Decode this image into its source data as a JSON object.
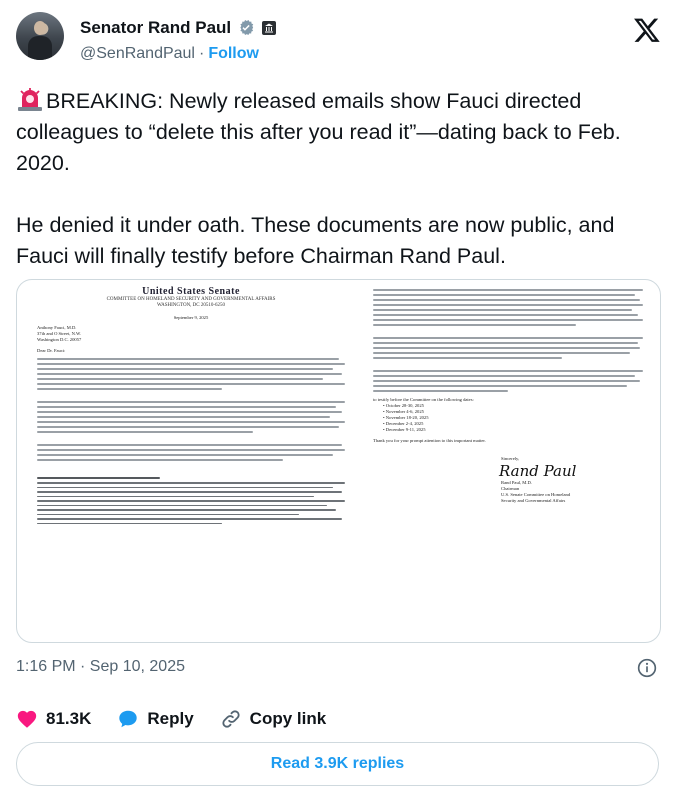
{
  "author": {
    "display_name": "Senator Rand Paul",
    "handle": "@SenRandPaul",
    "separator": "·",
    "follow_label": "Follow"
  },
  "tweet": {
    "paragraph1": "BREAKING: Newly released emails show Fauci directed colleagues to “delete this after you read it”—dating back to Feb. 2020.",
    "paragraph2": "He denied it under oath. These documents are now public, and Fauci will finally testify before Chairman Rand Paul."
  },
  "document": {
    "letterhead_title": "United States Senate",
    "letterhead_committee": "COMMITTEE ON HOMELAND SECURITY AND GOVERNMENTAL AFFAIRS",
    "letterhead_city": "WASHINGTON, DC 20510-6250",
    "date": "September 9, 2025",
    "address": [
      "Anthony Fauci, M.D.",
      "37th and O Street, N.W.",
      "Washington D.C. 20057"
    ],
    "salutation": "Dear Dr. Fauci:",
    "dates_intro": "to testify before the Committee on the following dates:",
    "dates": [
      "October 28-30, 2025",
      "November 4-6, 2025",
      "November 18-20, 2025",
      "December 2-4, 2025",
      "December 9-11, 2025"
    ],
    "thanks": "Thank you for your prompt attention to this important matter.",
    "closing": "Sincerely,",
    "signature": "Rand Paul",
    "signer": [
      "Rand Paul, M.D.",
      "Chairman",
      "U.S. Senate Committee on Homeland",
      "Security and Governmental Affairs"
    ]
  },
  "meta": {
    "timestamp": "1:16 PM · Sep 10, 2025"
  },
  "actions": {
    "likes": "81.3K",
    "reply_label": "Reply",
    "copy_link_label": "Copy link"
  },
  "read_replies_label": "Read 3.9K replies",
  "colors": {
    "accent": "#1d9bf0",
    "like": "#f91880",
    "text": "#0f1419",
    "muted": "#536471"
  }
}
